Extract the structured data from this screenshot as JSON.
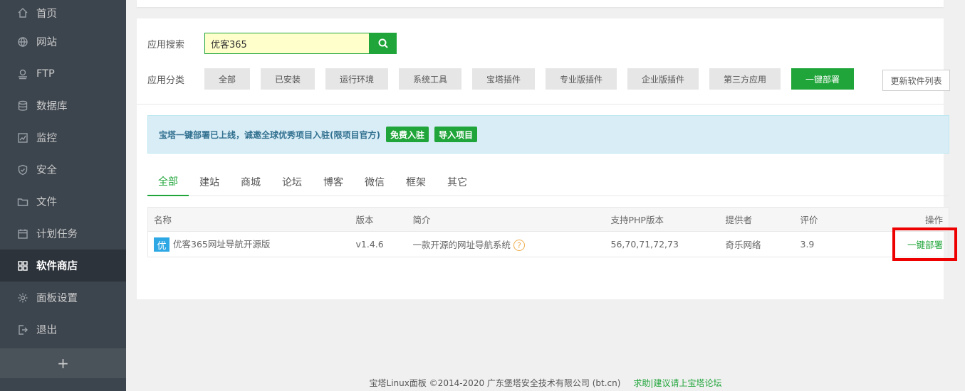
{
  "sidebar": {
    "items": [
      {
        "label": "首页",
        "icon": "home-icon"
      },
      {
        "label": "网站",
        "icon": "globe-icon"
      },
      {
        "label": "FTP",
        "icon": "ftp-icon"
      },
      {
        "label": "数据库",
        "icon": "database-icon"
      },
      {
        "label": "监控",
        "icon": "monitor-icon"
      },
      {
        "label": "安全",
        "icon": "shield-icon"
      },
      {
        "label": "文件",
        "icon": "folder-icon"
      },
      {
        "label": "计划任务",
        "icon": "calendar-icon"
      },
      {
        "label": "软件商店",
        "icon": "apps-icon",
        "active": true
      },
      {
        "label": "面板设置",
        "icon": "gear-icon"
      },
      {
        "label": "退出",
        "icon": "logout-icon"
      }
    ],
    "add_label": "+"
  },
  "search": {
    "label": "应用搜索",
    "value": "优客365"
  },
  "categories": {
    "label": "应用分类",
    "items": [
      "全部",
      "已安装",
      "运行环境",
      "系统工具",
      "宝塔插件",
      "专业版插件",
      "企业版插件",
      "第三方应用",
      "一键部署"
    ],
    "active": "一键部署",
    "refresh_label": "更新软件列表"
  },
  "notice": {
    "text": "宝塔一键部署已上线，诚邀全球优秀项目入驻(限项目官方)",
    "btn_free": "免费入驻",
    "btn_import": "导入项目"
  },
  "tabs": [
    "全部",
    "建站",
    "商城",
    "论坛",
    "博客",
    "微信",
    "框架",
    "其它"
  ],
  "table": {
    "headers": [
      "名称",
      "版本",
      "简介",
      "支持PHP版本",
      "提供者",
      "评价",
      "操作"
    ],
    "rows": [
      {
        "icon_char": "优",
        "name": "优客365网址导航开源版",
        "version": "v1.4.6",
        "desc": "一款开源的网址导航系统",
        "php": "56,70,71,72,73",
        "provider": "奇乐网络",
        "rating": "3.9",
        "action": "一键部署"
      }
    ]
  },
  "footer": {
    "copyright": "宝塔Linux面板 ©2014-2020 广东堡塔安全技术有限公司 (bt.cn)",
    "help_link": "求助|建议请上宝塔论坛"
  },
  "colors": {
    "accent": "#20a53a",
    "sidebar_bg": "#3c444d",
    "highlight": "#ee0000"
  }
}
